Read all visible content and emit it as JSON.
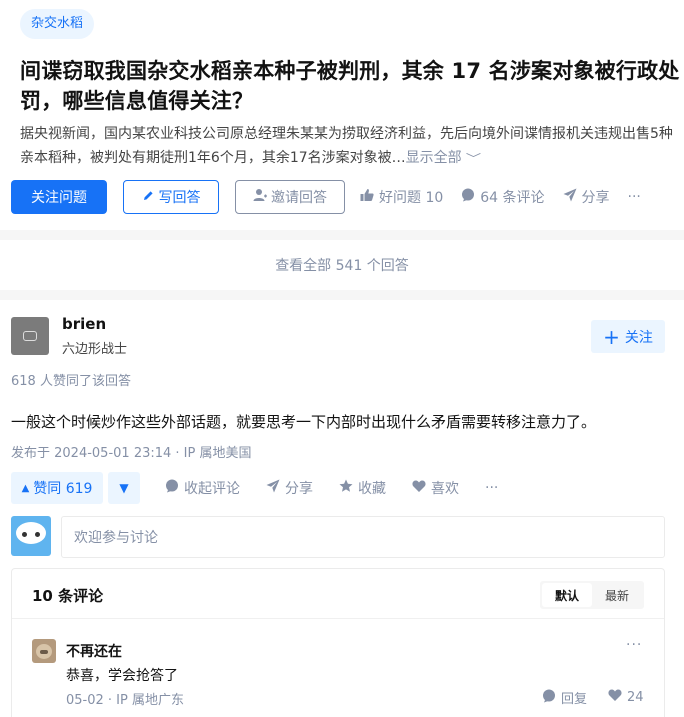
{
  "question": {
    "topic_tag": "杂交水稻",
    "title": "间谍窃取我国杂交水稻亲本种子被判刑，其余 17 名涉案对象被行政处罚，哪些信息值得关注？",
    "excerpt": "据央视新闻，国内某农业科技公司原总经理朱某某为捞取经济利益，先后向境外间谍情报机关违规出售5种亲本稻种，被判处有期徒刑1年6个月，其余17名涉案对象被…",
    "show_all_label": "显示全部",
    "buttons": {
      "follow": "关注问题",
      "write": "写回答",
      "invite": "邀请回答"
    },
    "actions": {
      "good_question": "好问题 10",
      "comments": "64 条评论",
      "share": "分享",
      "more": "···"
    }
  },
  "view_all_answers": "查看全部 541 个回答",
  "answer": {
    "author_name": "brien",
    "author_badge": "六边形战士",
    "follow_label": "关注",
    "voters_text": "618 人赞同了该回答",
    "content": "一般这个时候炒作这些外部话题，就要思考一下内部时出现什么矛盾需要转移注意力了。",
    "meta": "发布于 2024-05-01 23:14 · IP 属地美国",
    "vote_up_label": "赞同 619",
    "actions": {
      "collapse_comments": "收起评论",
      "share": "分享",
      "favorite": "收藏",
      "like": "喜欢",
      "more": "···"
    },
    "comment_input_placeholder": "欢迎参与讨论",
    "comments": {
      "count_label": "10 条评论",
      "sort_default": "默认",
      "sort_latest": "最新",
      "items": [
        {
          "author": "不再还在",
          "text": "恭喜，学会抢答了",
          "meta": "05-02 · IP 属地广东",
          "reply_label": "回复",
          "likes": "24"
        }
      ]
    }
  },
  "colors": {
    "brand": "#1772f6",
    "brand_light": "#ebf5ff",
    "muted": "#8590a6"
  }
}
